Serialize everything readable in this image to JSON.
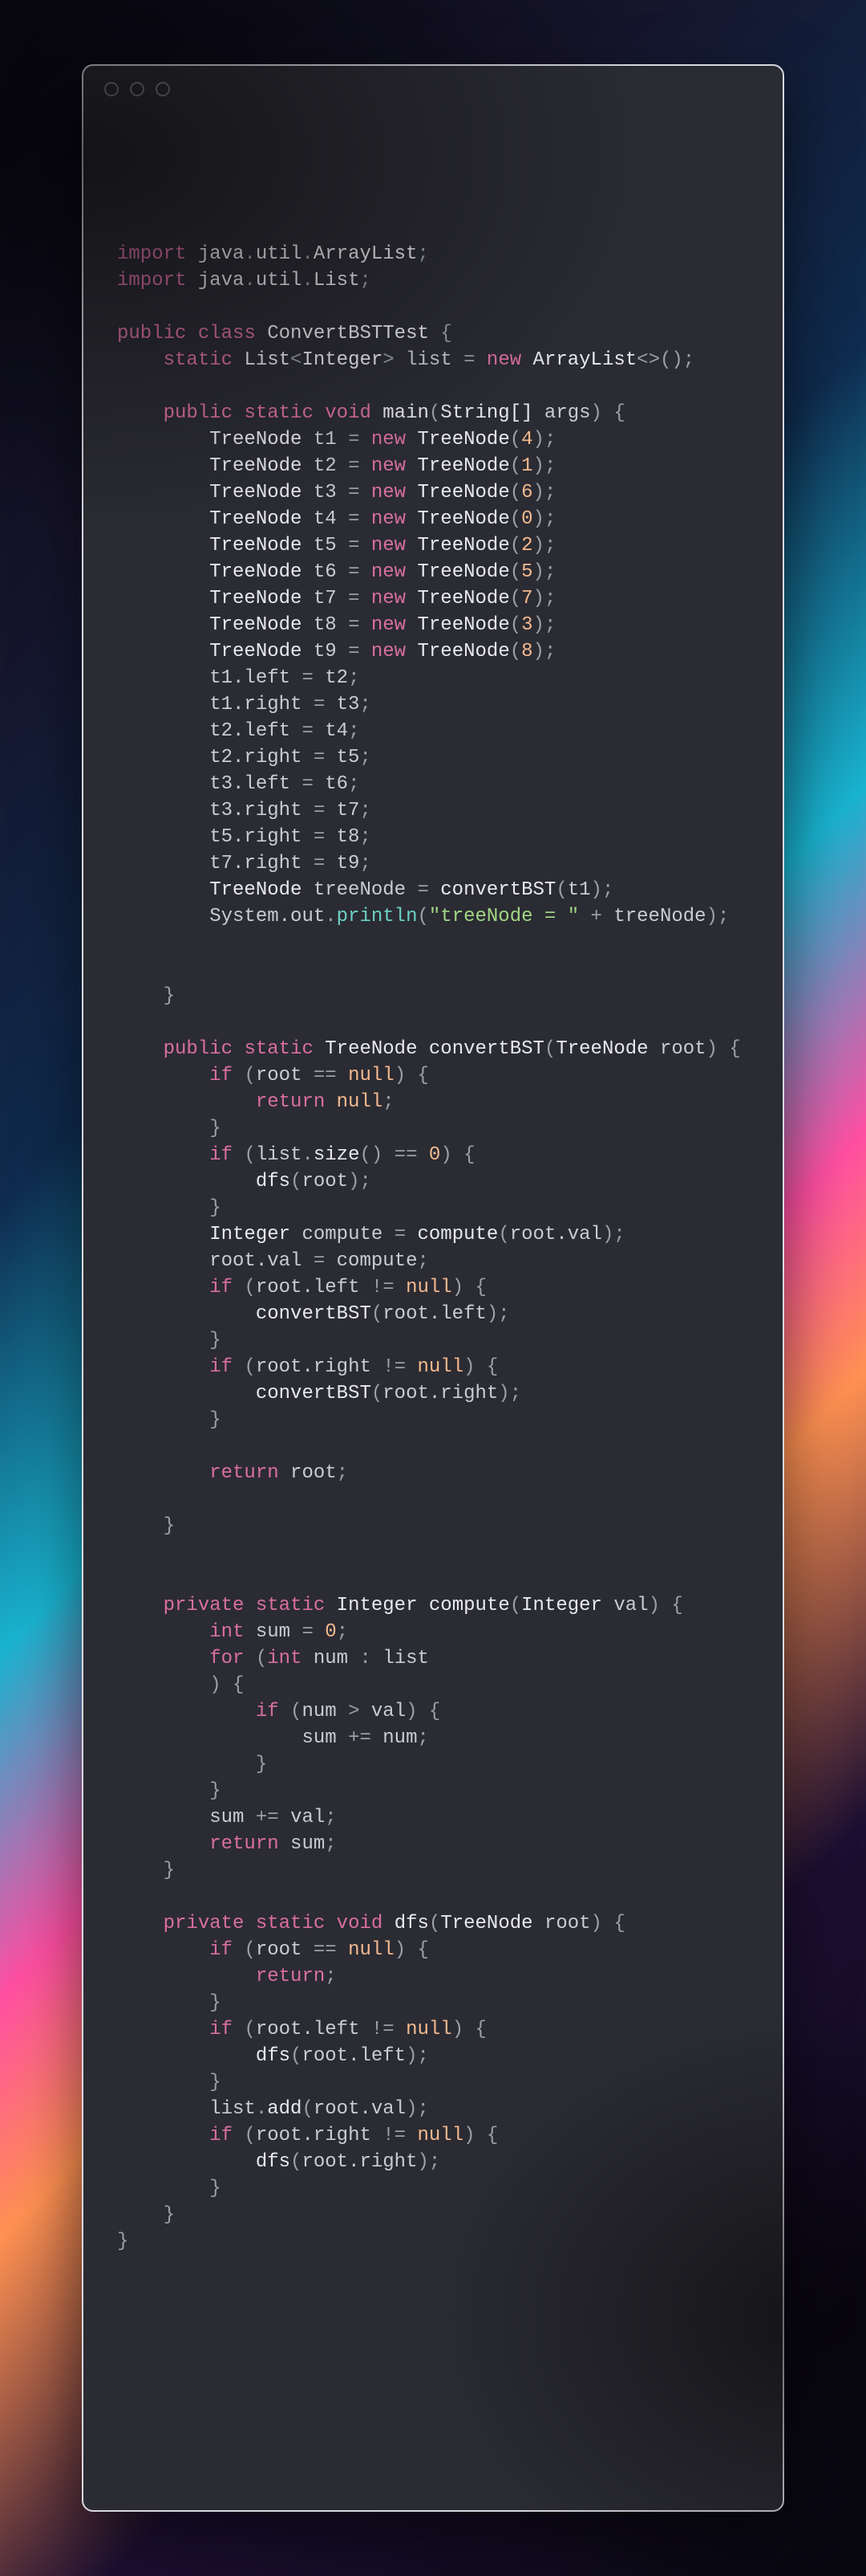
{
  "window": {
    "traffic_dots": 3
  },
  "code": {
    "imports": [
      {
        "pkg": [
          "java",
          "util"
        ],
        "cls": "ArrayList"
      },
      {
        "pkg": [
          "java",
          "util"
        ],
        "cls": "List"
      }
    ],
    "class_keywords": {
      "public": "public",
      "class": "class",
      "name": "ConvertBSTTest"
    },
    "field": {
      "mods": "static",
      "type_base": "List",
      "type_param": "Integer",
      "name": "list",
      "assign_kw": "new",
      "ctor": "ArrayList",
      "diamond": "<>",
      "parens": "()"
    },
    "main_sig": {
      "mods": [
        "public",
        "static"
      ],
      "ret": "void",
      "name": "main",
      "param_type": "String[]",
      "param_name": "args"
    },
    "treenodes": [
      {
        "var": "t1",
        "arg": "4"
      },
      {
        "var": "t2",
        "arg": "1"
      },
      {
        "var": "t3",
        "arg": "6"
      },
      {
        "var": "t4",
        "arg": "0"
      },
      {
        "var": "t5",
        "arg": "2"
      },
      {
        "var": "t6",
        "arg": "5"
      },
      {
        "var": "t7",
        "arg": "7"
      },
      {
        "var": "t8",
        "arg": "3"
      },
      {
        "var": "t9",
        "arg": "8"
      }
    ],
    "assigns": [
      {
        "lhs": "t1.left",
        "rhs": "t2"
      },
      {
        "lhs": "t1.right",
        "rhs": "t3"
      },
      {
        "lhs": "t2.left",
        "rhs": "t4"
      },
      {
        "lhs": "t2.right",
        "rhs": "t5"
      },
      {
        "lhs": "t3.left",
        "rhs": "t6"
      },
      {
        "lhs": "t3.right",
        "rhs": "t7"
      },
      {
        "lhs": "t5.right",
        "rhs": "t8"
      },
      {
        "lhs": "t7.right",
        "rhs": "t9"
      }
    ],
    "call_convert": {
      "type": "TreeNode",
      "var": "treeNode",
      "fn": "convertBST",
      "arg": "t1"
    },
    "println": {
      "obj": "System.out",
      "method": "println",
      "str": "\"treeNode = \"",
      "plus": " + ",
      "arg": "treeNode"
    },
    "convertBST_sig": {
      "mods": [
        "public",
        "static"
      ],
      "ret": "TreeNode",
      "name": "convertBST",
      "param_type": "TreeNode",
      "param_name": "root"
    },
    "convertBST_body": {
      "null1_cond_lhs": "root",
      "null1_cond_op": "==",
      "null1_cond_rhs": "null",
      "return_null": "null",
      "size_obj": "list",
      "size_method": "size",
      "size_cmp_op": "==",
      "size_cmp_rhs": "0",
      "dfs_call": {
        "name": "dfs",
        "arg": "root"
      },
      "compute_line": {
        "type": "Integer",
        "var": "compute",
        "fn": "compute",
        "arg": "root.val"
      },
      "assign_rootval": {
        "lhs": "root.val",
        "rhs": "compute"
      },
      "left_cond_lhs": "root.left",
      "left_cond_op": "!=",
      "left_cond_rhs": "null",
      "left_call": {
        "fn": "convertBST",
        "arg": "root.left"
      },
      "right_cond_lhs": "root.right",
      "right_cond_op": "!=",
      "right_cond_rhs": "null",
      "right_call": {
        "fn": "convertBST",
        "arg": "root.right"
      },
      "return_root": "root"
    },
    "compute_sig": {
      "mods": [
        "private",
        "static"
      ],
      "ret": "Integer",
      "name": "compute",
      "param_type": "Integer",
      "param_name": "val"
    },
    "compute_body": {
      "decl": {
        "type": "int",
        "name": "sum",
        "init": "0"
      },
      "for_header1": {
        "type": "int",
        "var": "num",
        "colon": ":",
        "iter": "list"
      },
      "if_cond": {
        "lhs": "num",
        "op": ">",
        "rhs": "val"
      },
      "accum": {
        "lhs": "sum",
        "op": "+=",
        "rhs": "num"
      },
      "accum2": {
        "lhs": "sum",
        "op": "+=",
        "rhs": "val"
      },
      "ret": "sum"
    },
    "dfs_sig": {
      "mods": [
        "private",
        "static"
      ],
      "ret": "void",
      "name": "dfs",
      "param_type": "TreeNode",
      "param_name": "root"
    },
    "dfs_body": {
      "null_cond_lhs": "root",
      "null_cond_op": "==",
      "null_cond_rhs": "null",
      "left_cond_lhs": "root.left",
      "left_cond_op": "!=",
      "left_cond_rhs": "null",
      "left_call": {
        "fn": "dfs",
        "arg": "root.left"
      },
      "add_obj": "list",
      "add_method": "add",
      "add_arg": "root.val",
      "right_cond_lhs": "root.right",
      "right_cond_op": "!=",
      "right_cond_rhs": "null",
      "right_call": {
        "fn": "dfs",
        "arg": "root.right"
      }
    },
    "kw": {
      "import": "import",
      "public": "public",
      "private": "private",
      "class": "class",
      "static": "static",
      "void": "void",
      "new": "new",
      "if": "if",
      "for": "for",
      "return": "return",
      "int": "int",
      "null": "null"
    }
  }
}
